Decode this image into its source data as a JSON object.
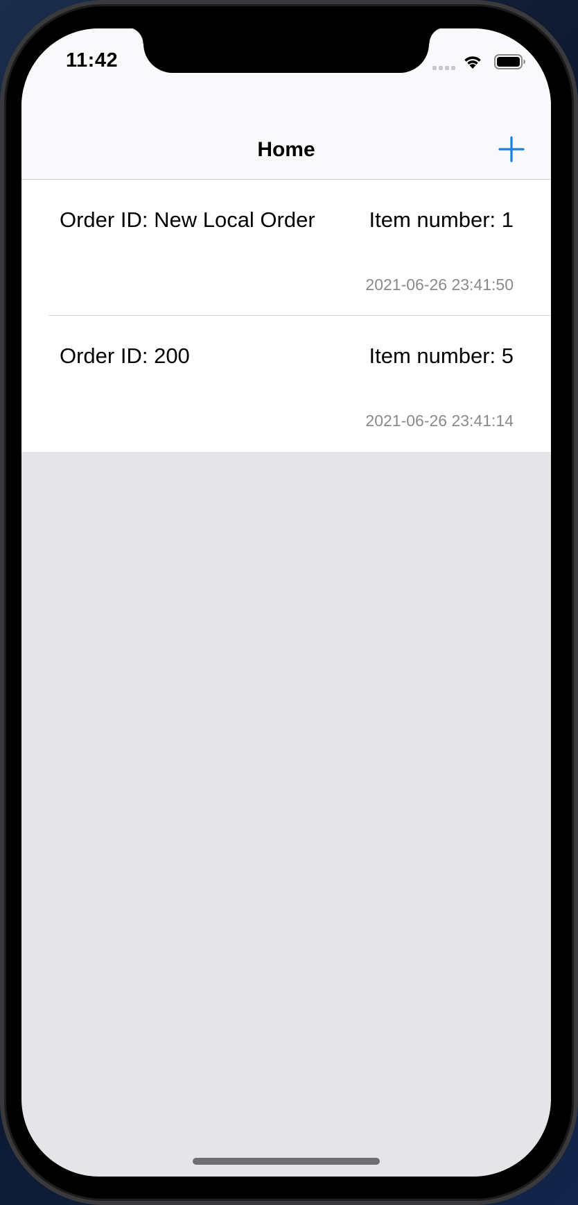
{
  "status_bar": {
    "time": "11:42",
    "icons": [
      "signal-dots-icon",
      "wifi-icon",
      "battery-icon"
    ]
  },
  "nav": {
    "title": "Home",
    "add_icon": "plus-icon"
  },
  "orders": [
    {
      "order_id": "Order ID: New Local Order",
      "item_number": "Item number: 1",
      "timestamp": "2021-06-26 23:41:50"
    },
    {
      "order_id": "Order ID: 200",
      "item_number": "Item number: 5",
      "timestamp": "2021-06-26 23:41:14"
    }
  ],
  "colors": {
    "accent": "#1a7fe0",
    "background": "#e4e4e9",
    "secondary_text": "#8a8a8e"
  }
}
